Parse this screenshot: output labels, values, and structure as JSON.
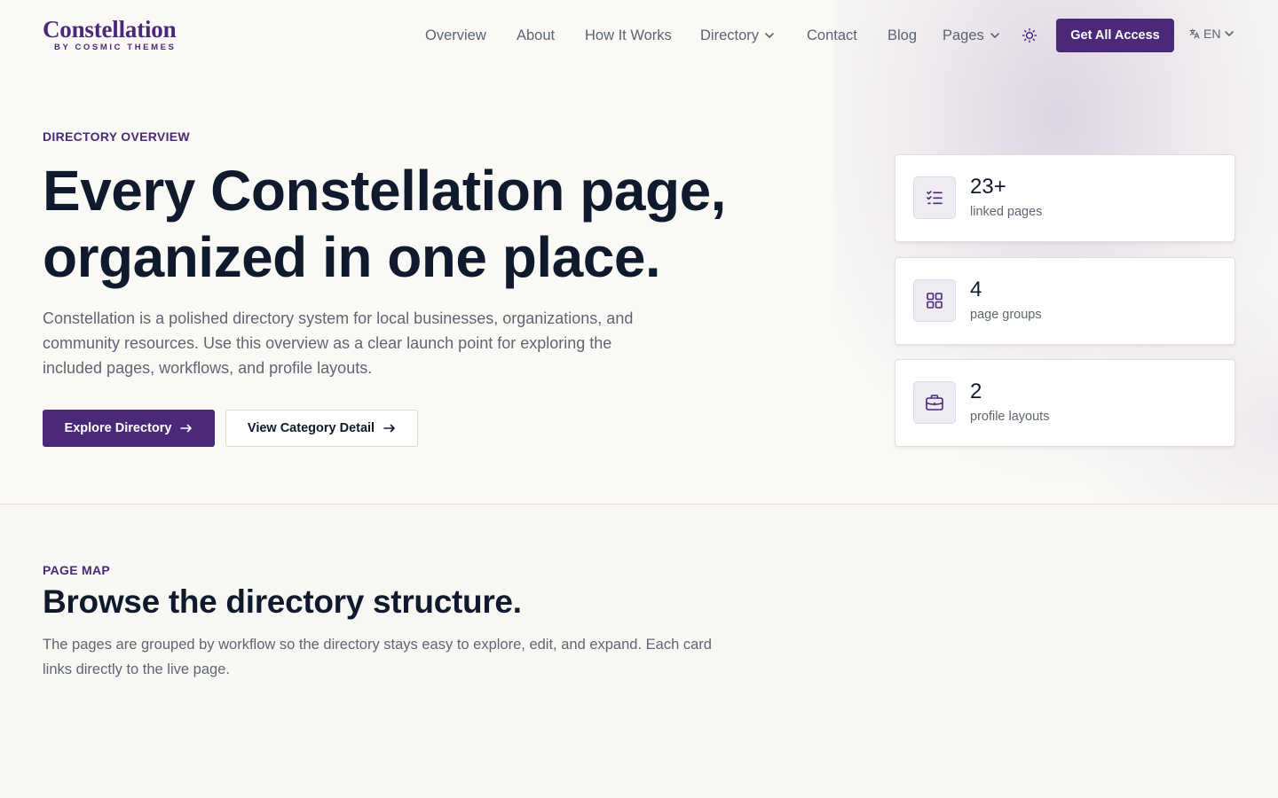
{
  "brand": {
    "name": "Constellation",
    "sub": "BY COSMIC THEMES"
  },
  "nav": {
    "items": [
      {
        "label": "Overview"
      },
      {
        "label": "About"
      },
      {
        "label": "How It Works"
      },
      {
        "label": "Directory",
        "dropdown": true
      },
      {
        "label": "Contact"
      },
      {
        "label": "Blog"
      },
      {
        "label": "Pages",
        "dropdown": true
      }
    ],
    "theme_icon": "sun-icon",
    "cta_label": "Get All Access",
    "language": "EN"
  },
  "hero": {
    "eyebrow": "DIRECTORY OVERVIEW",
    "title": "Every Constellation page, organized in one place.",
    "description": "Constellation is a polished directory system for local businesses, organizations, and community resources. Use this overview as a clear launch point for exploring the included pages, workflows, and profile layouts.",
    "primary_button": "Explore Directory",
    "secondary_button": "View Category Detail"
  },
  "stats": [
    {
      "value": "23+",
      "label": "linked pages",
      "icon": "list-check-icon"
    },
    {
      "value": "4",
      "label": "page groups",
      "icon": "grid-icon"
    },
    {
      "value": "2",
      "label": "profile layouts",
      "icon": "briefcase-icon"
    }
  ],
  "page_map": {
    "eyebrow": "PAGE MAP",
    "title": "Browse the directory structure.",
    "description": "The pages are grouped by workflow so the directory stays easy to explore, edit, and expand. Each card links directly to the live page."
  },
  "colors": {
    "accent": "#4a2a78",
    "text": "#0f1b2d",
    "muted": "#5f6672",
    "background": "#f8f7f4"
  }
}
